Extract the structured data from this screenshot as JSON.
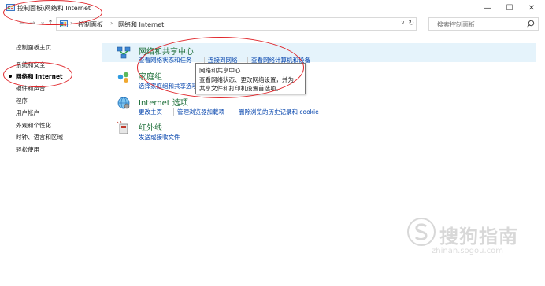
{
  "window": {
    "title": "控制面板\\网络和 Internet",
    "minimize": "—",
    "maximize": "☐",
    "close": "✕"
  },
  "address": {
    "crumbs": [
      "控制面板",
      "网络和 Internet"
    ],
    "separator": "›",
    "search_placeholder": "搜索控制面板"
  },
  "sidebar": {
    "items": [
      {
        "label": "控制面板主页"
      },
      {
        "label": "系统和安全"
      },
      {
        "label": "网络和 Internet",
        "current": true
      },
      {
        "label": "硬件和声音"
      },
      {
        "label": "程序"
      },
      {
        "label": "用户帐户"
      },
      {
        "label": "外观和个性化"
      },
      {
        "label": "时钟、语言和区域"
      },
      {
        "label": "轻松使用"
      }
    ]
  },
  "categories": [
    {
      "title": "网络和共享中心",
      "icon": "network-sharing-icon",
      "links": [
        "查看网络状态和任务",
        "连接到网络",
        "查看网络计算机和设备"
      ]
    },
    {
      "title": "家庭组",
      "icon": "homegroup-icon",
      "links": [
        "选择家庭组和共享选项"
      ]
    },
    {
      "title": "Internet 选项",
      "icon": "internet-options-icon",
      "links": [
        "更改主页",
        "管理浏览器加载项",
        "删除浏览的历史记录和 cookie"
      ]
    },
    {
      "title": "红外线",
      "icon": "infrared-icon",
      "links": [
        "发送或接收文件"
      ]
    }
  ],
  "tooltip": {
    "lines": [
      "网络和共享中心",
      "查看网络状态、更改网络设置，并为",
      "共享文件和打印机设置首选项。"
    ]
  },
  "watermark": {
    "text": "搜狗指南",
    "url": "zhinan.sogou.com"
  },
  "colors": {
    "link": "#0645ad",
    "category_title": "#1e6f3a",
    "highlight": "#e5f3fb",
    "annotation": "#e0262b"
  }
}
